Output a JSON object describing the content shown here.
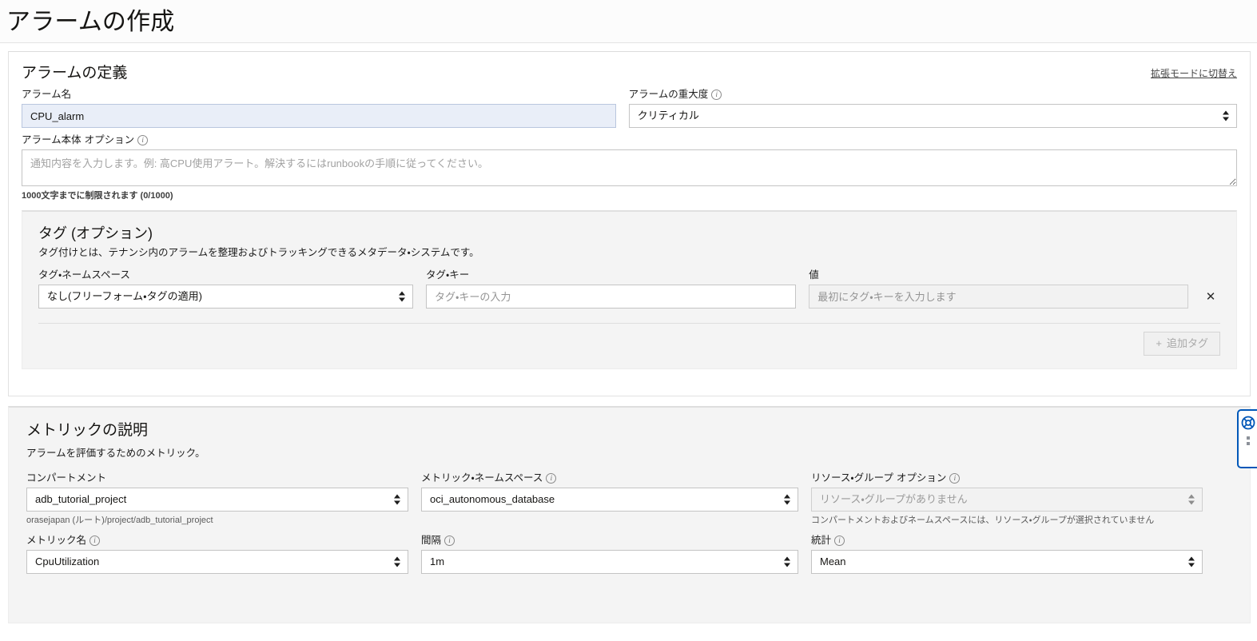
{
  "page": {
    "title": "アラームの作成"
  },
  "alarm_definition": {
    "section_title": "アラームの定義",
    "switch_mode_link": "拡張モードに切替え",
    "alarm_name": {
      "label": "アラーム名",
      "value": "CPU_alarm"
    },
    "alarm_severity": {
      "label": "アラームの重大度",
      "info_icon": "info-icon",
      "value": "クリティカル"
    },
    "alarm_body": {
      "label": "アラーム本体",
      "optional": "オプション",
      "info_icon": "info-icon",
      "value": "",
      "placeholder": "通知内容を入力します。例: 高CPU使用アラート。解決するにはrunbookの手順に従ってください。",
      "counter": "1000文字までに制限されます (0/1000)"
    }
  },
  "tags": {
    "title": "タグ (オプション)",
    "description": "タグ付けとは、テナンシ内のアラームを整理およびトラッキングできるメタデータ・システムです。",
    "namespace": {
      "label": "タグ・ネームスペース",
      "value": "なし(フリーフォーム・タグの適用)"
    },
    "key": {
      "label": "タグ・キー",
      "value": "",
      "placeholder": "タグ・キーの入力"
    },
    "value_field": {
      "label": "値",
      "value": "",
      "placeholder": "最初にタグ・キーを入力します"
    },
    "remove_icon": "close-icon",
    "add_tag_button": "追加タグ",
    "add_tag_plus": "+"
  },
  "metric_description": {
    "title": "メトリックの説明",
    "description": "アラームを評価するためのメトリック。",
    "compartment": {
      "label": "コンパートメント",
      "value": "adb_tutorial_project",
      "helper": "orasejapan (ルート)/project/adb_tutorial_project"
    },
    "metric_namespace": {
      "label": "メトリック・ネームスペース",
      "info_icon": "info-icon",
      "value": "oci_autonomous_database"
    },
    "resource_group": {
      "label": "リソース・グループ",
      "optional": "オプション",
      "info_icon": "info-icon",
      "value": "",
      "placeholder": "リソース・グループがありません",
      "helper": "コンパートメントおよびネームスペースには、リソース・グループが選択されていません"
    },
    "metric_name": {
      "label": "メトリック名",
      "info_icon": "info-icon",
      "value": "CpuUtilization"
    },
    "interval": {
      "label": "間隔",
      "info_icon": "info-icon",
      "value": "1m"
    },
    "statistic": {
      "label": "統計",
      "info_icon": "info-icon",
      "value": "Mean"
    }
  },
  "help_widget": {
    "icon": "lifebuoy-icon",
    "drag_handle": "drag-handle-icon"
  },
  "colors": {
    "accent": "#0057b8",
    "focus_field_bg": "#e9eef8",
    "panel_bg": "#f4f4f4"
  }
}
